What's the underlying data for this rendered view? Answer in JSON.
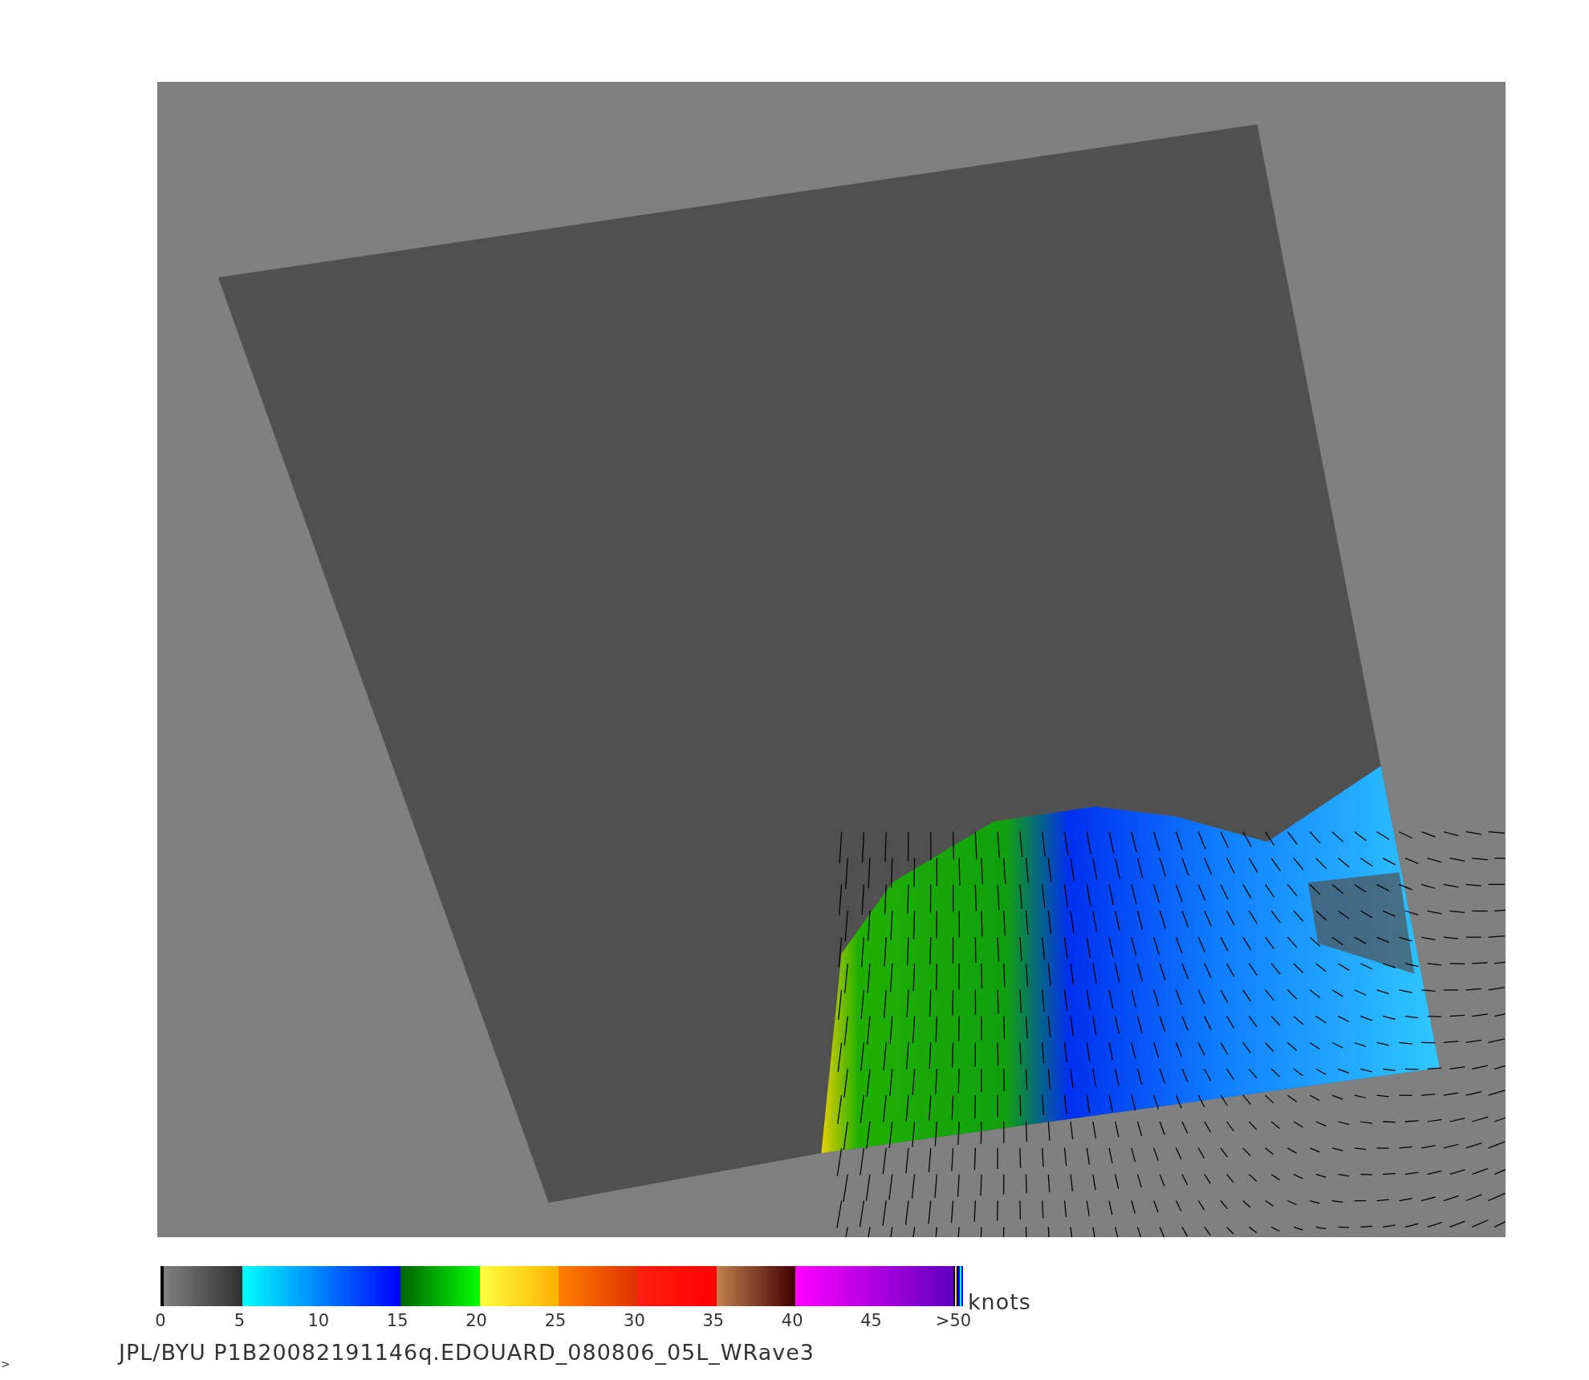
{
  "colorbar": {
    "ticks": [
      "0",
      "5",
      "10",
      "15",
      "20",
      "25",
      "30",
      "35",
      "40",
      "45",
      ">50"
    ],
    "unit": "knots"
  },
  "caption": "JPL/BYU  P1B20082191146q.EDOUARD_080806_05L_WRave3",
  "edge_mark": ">"
}
